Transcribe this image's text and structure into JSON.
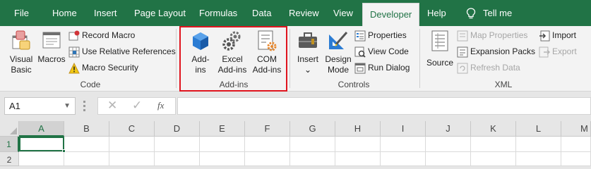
{
  "tabs": [
    "File",
    "Home",
    "Insert",
    "Page Layout",
    "Formulas",
    "Data",
    "Review",
    "View",
    "Developer",
    "Help"
  ],
  "tell_me": "Tell me",
  "ribbon": {
    "code": {
      "label": "Code",
      "visual_basic": [
        "Visual",
        "Basic"
      ],
      "macros": "Macros",
      "record_macro": "Record Macro",
      "use_relative": "Use Relative References",
      "macro_security": "Macro Security"
    },
    "addins": {
      "label": "Add-ins",
      "addins_btn": [
        "Add-",
        "ins"
      ],
      "excel_addins": [
        "Excel",
        "Add-ins"
      ],
      "com_addins": [
        "COM",
        "Add-ins"
      ]
    },
    "controls": {
      "label": "Controls",
      "insert": "Insert",
      "design_mode": [
        "Design",
        "Mode"
      ],
      "properties": "Properties",
      "view_code": "View Code",
      "run_dialog": "Run Dialog"
    },
    "xml": {
      "label": "XML",
      "source": "Source",
      "map_properties": "Map Properties",
      "expansion_packs": "Expansion Packs",
      "refresh_data": "Refresh Data",
      "import": "Import",
      "export": "Export"
    }
  },
  "formula_bar": {
    "name_box": "A1",
    "fx": "fx",
    "formula": ""
  },
  "columns": [
    "A",
    "B",
    "C",
    "D",
    "E",
    "F",
    "G",
    "H",
    "I",
    "J",
    "K",
    "L",
    "M"
  ],
  "rows": [
    "1",
    "2"
  ],
  "colors": {
    "accent": "#217346",
    "highlight": "#e0141e"
  }
}
